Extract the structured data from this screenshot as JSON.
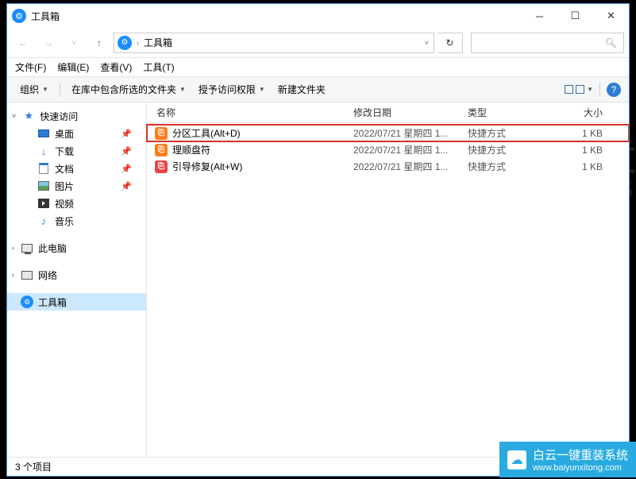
{
  "window": {
    "title": "工具箱"
  },
  "breadcrumb": {
    "label": "工具箱"
  },
  "menubar": {
    "file": "文件(F)",
    "edit": "编辑(E)",
    "view": "查看(V)",
    "tools": "工具(T)"
  },
  "toolbar": {
    "organize": "组织",
    "include": "在库中包含所选的文件夹",
    "access": "授予访问权限",
    "newfolder": "新建文件夹"
  },
  "sidebar": {
    "quick": "快速访问",
    "desktop": "桌面",
    "downloads": "下载",
    "documents": "文档",
    "pictures": "图片",
    "videos": "视频",
    "music": "音乐",
    "pc": "此电脑",
    "network": "网络",
    "toolbox": "工具箱"
  },
  "columns": {
    "name": "名称",
    "date": "修改日期",
    "type": "类型",
    "size": "大小"
  },
  "files": [
    {
      "name": "分区工具(Alt+D)",
      "date": "2022/07/21 星期四 1...",
      "type": "快捷方式",
      "size": "1 KB",
      "color": "orange",
      "highlight": true
    },
    {
      "name": "理顺盘符",
      "date": "2022/07/21 星期四 1...",
      "type": "快捷方式",
      "size": "1 KB",
      "color": "orange",
      "highlight": false
    },
    {
      "name": "引导修复(Alt+W)",
      "date": "2022/07/21 星期四 1...",
      "type": "快捷方式",
      "size": "1 KB",
      "color": "red",
      "highlight": false
    }
  ],
  "status": {
    "count": "3 个项目"
  },
  "watermark": {
    "text": "白云一键重装系统",
    "url": "www.baiyunxitong.com"
  }
}
